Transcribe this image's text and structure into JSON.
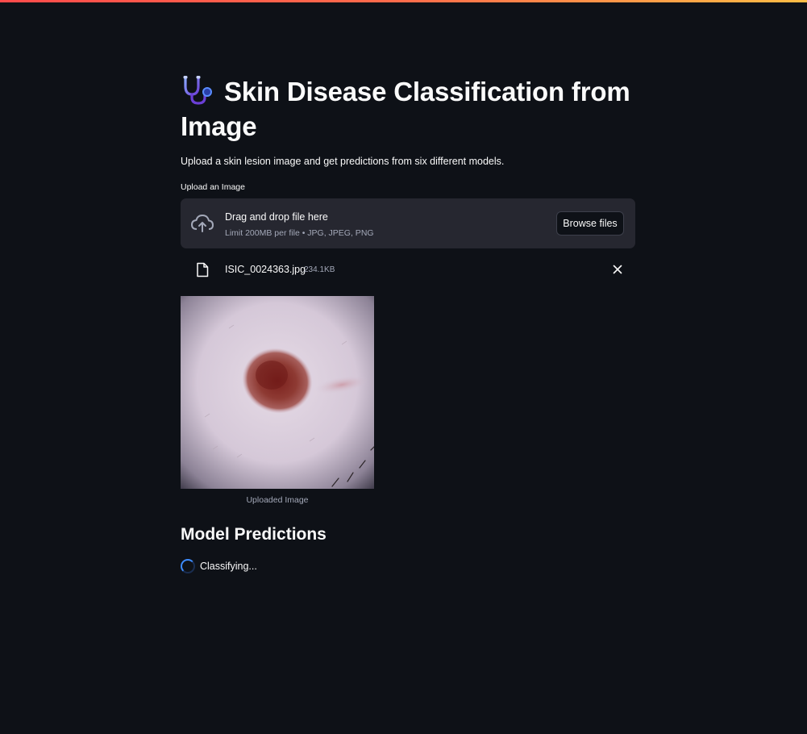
{
  "app": {
    "title": "Skin Disease Classification from Image",
    "title_icon": "stethoscope-icon",
    "subtitle": "Upload a skin lesion image and get predictions from six different models.",
    "accent_gradient": [
      "#ff4b4b",
      "#ffbd45"
    ]
  },
  "uploader": {
    "label": "Upload an Image",
    "dropzone_main": "Drag and drop file here",
    "dropzone_sub": "Limit 200MB per file • JPG, JPEG, PNG",
    "browse_label": "Browse files",
    "icon": "cloud-upload-icon"
  },
  "file": {
    "name": "ISIC_0024363.jpg",
    "size": "234.1KB",
    "icon": "file-icon",
    "remove_icon": "close-icon"
  },
  "preview": {
    "caption": "Uploaded Image"
  },
  "predictions": {
    "heading": "Model Predictions",
    "status": "Classifying..."
  },
  "colors": {
    "background": "#0e1117",
    "panel": "#262730",
    "spinner": "#3d8bfd"
  }
}
